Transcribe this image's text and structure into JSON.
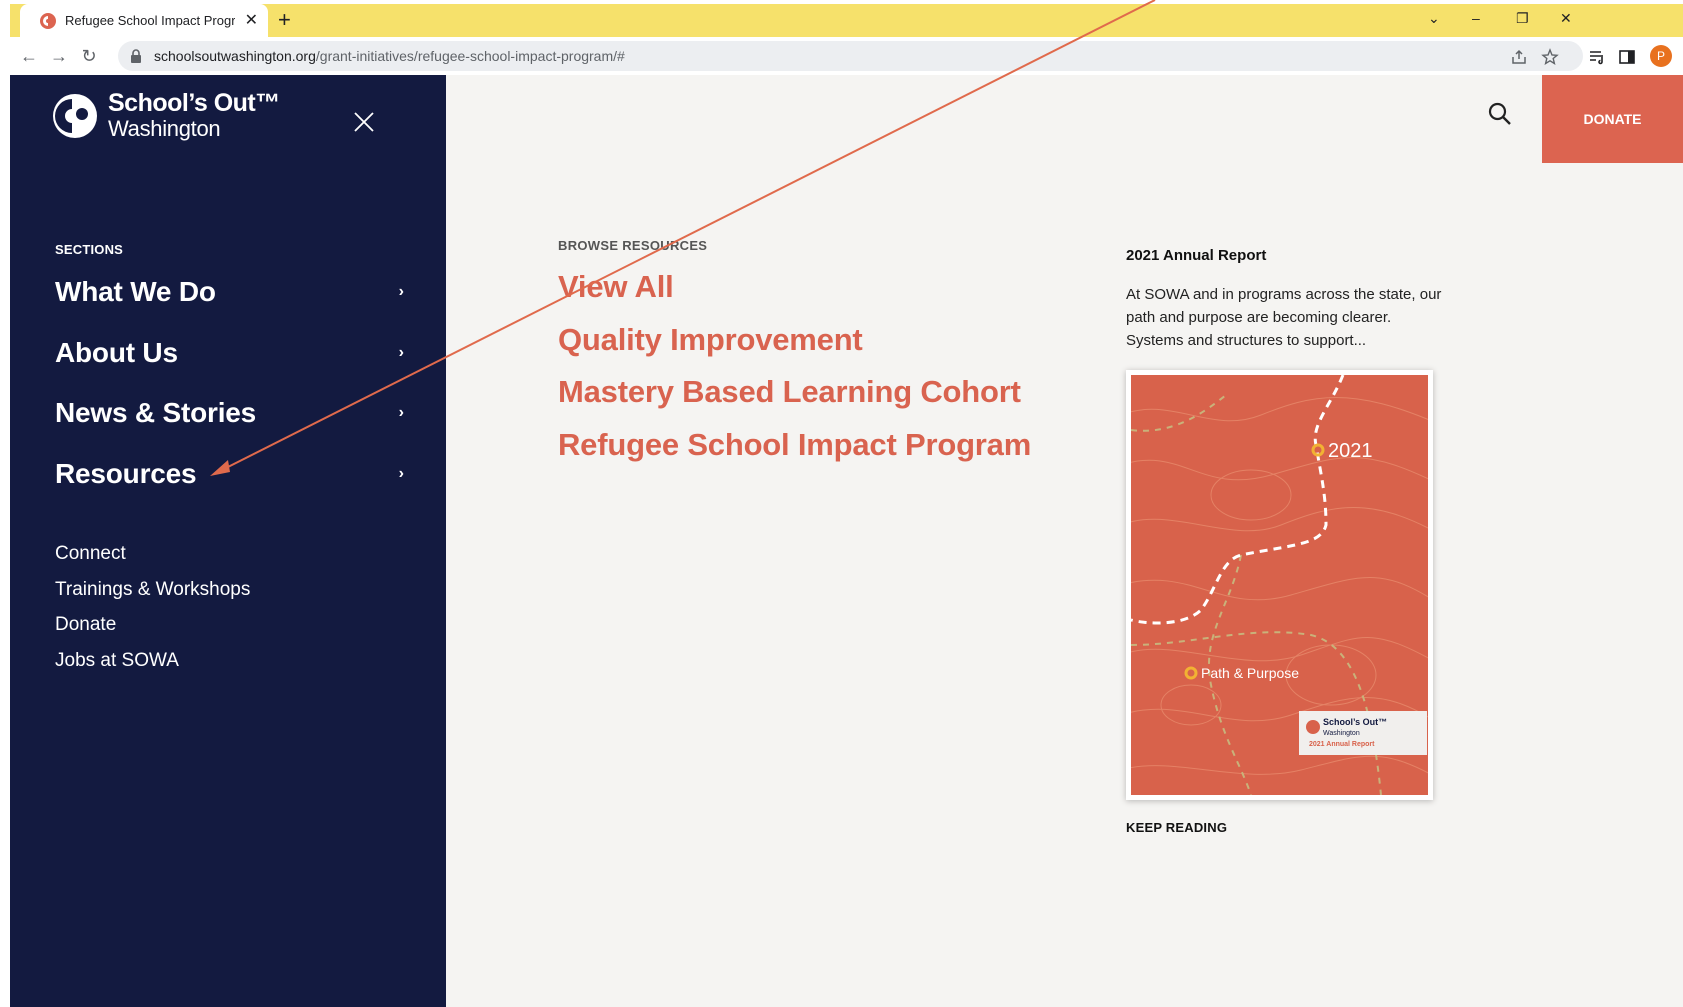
{
  "browser": {
    "tab_title": "Refugee School Impact Program",
    "new_tab_label": "+",
    "url_host": "schoolsoutwashington.org",
    "url_path": "/grant-initiatives/refugee-school-impact-program/#",
    "profile_initial": "P",
    "accent_color": "#f6e16b"
  },
  "site": {
    "logo_line1": "School’s Out™",
    "logo_line2": "Washington",
    "donate_label": "DONATE"
  },
  "menu": {
    "sections_label": "SECTIONS",
    "main_items": [
      {
        "label": "What We Do",
        "chevron": "›"
      },
      {
        "label": "About Us",
        "chevron": "›"
      },
      {
        "label": "News & Stories",
        "chevron": "›"
      },
      {
        "label": "Resources",
        "chevron": "›"
      }
    ],
    "secondary_items": [
      "Connect",
      "Trainings & Workshops",
      "Donate",
      "Jobs at SOWA"
    ]
  },
  "browse": {
    "label": "BROWSE RESOURCES",
    "links": [
      "View All",
      "Quality Improvement",
      "Mastery Based Learning Cohort",
      "Refugee School Impact Program"
    ]
  },
  "report": {
    "title": "2021 Annual Report",
    "description": "At SOWA and in programs across the state, our path and purpose are becoming clearer. Systems and structures to support...",
    "cover_year": "2021",
    "cover_subtitle": "Path & Purpose",
    "cover_badge_line1": "School’s Out™",
    "cover_badge_line2": "Washington",
    "cover_badge_line3": "2021 Annual Report",
    "keep_reading": "KEEP READING"
  },
  "colors": {
    "sidebar": "#131a40",
    "accent": "#dc6450",
    "page_bg": "#f5f4f2"
  }
}
